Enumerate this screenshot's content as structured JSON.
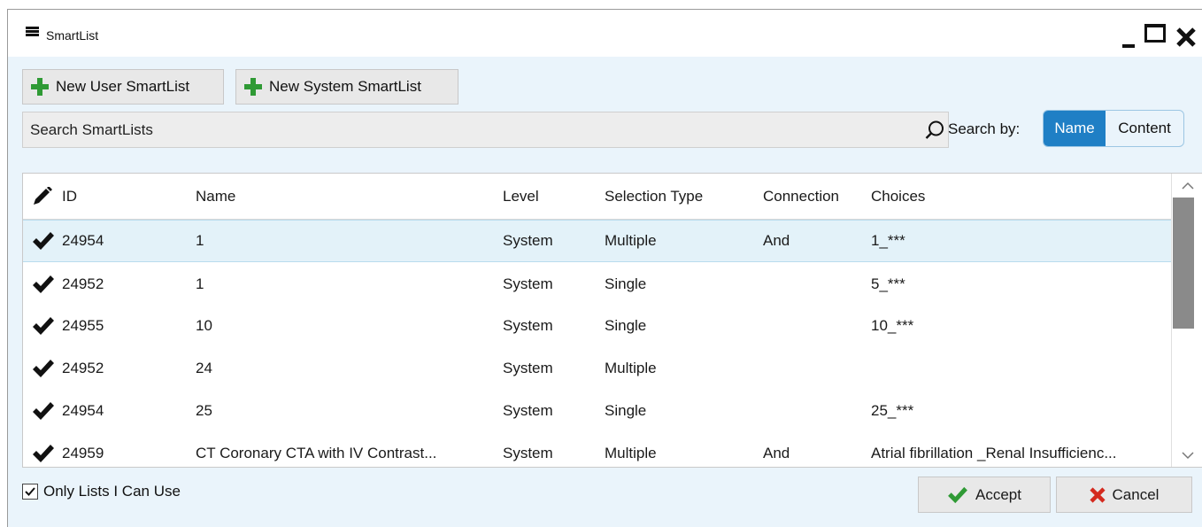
{
  "window": {
    "title": "SmartList"
  },
  "toolbar": {
    "new_user_label": "New User SmartList",
    "new_system_label": "New System SmartList"
  },
  "search": {
    "placeholder": "Search SmartLists",
    "search_by_label": "Search by:",
    "options": [
      "Name",
      "Content"
    ],
    "selected": "Name"
  },
  "table": {
    "columns": {
      "id": "ID",
      "name": "Name",
      "level": "Level",
      "selection_type": "Selection Type",
      "connection": "Connection",
      "choices": "Choices"
    },
    "rows": [
      {
        "id": "24954",
        "name": "1",
        "level": "System",
        "selection_type": "Multiple",
        "connection": "And",
        "choices": "1_***",
        "selected": true
      },
      {
        "id": "24952",
        "name": "1",
        "level": "System",
        "selection_type": "Single",
        "connection": "",
        "choices": "5_***",
        "selected": false
      },
      {
        "id": "24955",
        "name": "10",
        "level": "System",
        "selection_type": "Single",
        "connection": "",
        "choices": "10_***",
        "selected": false
      },
      {
        "id": "24952",
        "name": "24",
        "level": "System",
        "selection_type": "Multiple",
        "connection": "",
        "choices": "",
        "selected": false
      },
      {
        "id": "24954",
        "name": "25",
        "level": "System",
        "selection_type": "Single",
        "connection": "",
        "choices": "25_***",
        "selected": false
      },
      {
        "id": "24959",
        "name": "CT Coronary CTA with IV Contrast...",
        "level": "System",
        "selection_type": "Multiple",
        "connection": "And",
        "choices": "Atrial fibrillation _Renal Insufficienc...",
        "selected": false
      }
    ]
  },
  "footer": {
    "only_lists_label": "Only Lists I Can Use",
    "only_lists_checked": true,
    "accept_label": "Accept",
    "cancel_label": "Cancel"
  },
  "colors": {
    "accent": "#1f7fc5",
    "plus_green": "#2f9a35",
    "cancel_red": "#d42a1e",
    "panel_bg": "#eaf4fb",
    "selected_row": "#e3f2f9"
  }
}
